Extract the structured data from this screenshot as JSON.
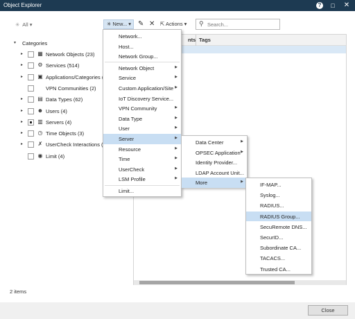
{
  "window": {
    "title": "Object Explorer",
    "help_glyph": "?",
    "maximize_glyph": "□",
    "close_glyph": "✕"
  },
  "toolbar": {
    "filter_label": "All",
    "new_label": "New...",
    "actions_label": "Actions",
    "search_placeholder": "Search..."
  },
  "tree": {
    "root_label": "Categories",
    "items": [
      {
        "label": "Network Objects (23)",
        "icon": "network-icon",
        "checked": false,
        "expandable": true
      },
      {
        "label": "Services (514)",
        "icon": "services-icon",
        "checked": false,
        "expandable": true
      },
      {
        "label": "Applications/Categories (",
        "icon": "applications-icon",
        "checked": false,
        "expandable": true
      },
      {
        "label": "VPN Communities (2)",
        "icon": "",
        "checked": false,
        "expandable": false
      },
      {
        "label": "Data Types (62)",
        "icon": "data-types-icon",
        "checked": false,
        "expandable": true
      },
      {
        "label": "Users (4)",
        "icon": "users-icon",
        "checked": false,
        "expandable": true
      },
      {
        "label": "Servers (4)",
        "icon": "servers-icon",
        "checked": true,
        "expandable": true
      },
      {
        "label": "Time Objects (3)",
        "icon": "time-icon",
        "checked": false,
        "expandable": true
      },
      {
        "label": "UserCheck Interactions (1",
        "icon": "usercheck-icon",
        "checked": false,
        "expandable": true
      },
      {
        "label": "Limit (4)",
        "icon": "limit-icon",
        "checked": false,
        "expandable": false
      }
    ]
  },
  "grid": {
    "columns": [
      "nts",
      "Tags"
    ]
  },
  "status": {
    "item_count": "2 items"
  },
  "footer": {
    "close_label": "Close"
  },
  "menu_new": {
    "items": [
      {
        "label": "Network...",
        "submenu": false
      },
      {
        "label": "Host...",
        "submenu": false
      },
      {
        "label": "Network Group...",
        "submenu": false
      },
      {
        "label": "Network Object",
        "submenu": true
      },
      {
        "label": "Service",
        "submenu": true
      },
      {
        "label": "Custom Application/Site",
        "submenu": true
      },
      {
        "label": "IoT Discovery Service...",
        "submenu": false
      },
      {
        "label": "VPN Community",
        "submenu": true
      },
      {
        "label": "Data Type",
        "submenu": true
      },
      {
        "label": "User",
        "submenu": true
      },
      {
        "label": "Server",
        "submenu": true,
        "highlighted": true
      },
      {
        "label": "Resource",
        "submenu": true
      },
      {
        "label": "Time",
        "submenu": true
      },
      {
        "label": "UserCheck",
        "submenu": true
      },
      {
        "label": "LSM Profile",
        "submenu": true
      },
      {
        "label": "Limit...",
        "submenu": false
      }
    ]
  },
  "menu_server": {
    "items": [
      {
        "label": "Data Center",
        "submenu": true
      },
      {
        "label": "OPSEC Application",
        "submenu": true
      },
      {
        "label": "Identity Provider...",
        "submenu": false
      },
      {
        "label": "LDAP Account Unit...",
        "submenu": false
      },
      {
        "label": "More",
        "submenu": true,
        "highlighted": true
      }
    ]
  },
  "menu_more": {
    "items": [
      {
        "label": "IF-MAP...",
        "submenu": false
      },
      {
        "label": "Syslog...",
        "submenu": false
      },
      {
        "label": "RADIUS...",
        "submenu": false
      },
      {
        "label": "RADIUS Group...",
        "submenu": false,
        "highlighted": true
      },
      {
        "label": "SecuRemote DNS...",
        "submenu": false
      },
      {
        "label": "SecurID...",
        "submenu": false
      },
      {
        "label": "Subordinate CA...",
        "submenu": false
      },
      {
        "label": "TACACS...",
        "submenu": false
      },
      {
        "label": "Trusted CA...",
        "submenu": false
      }
    ]
  },
  "colors": {
    "titlebar": "#1d3a52",
    "highlight": "#c8def3",
    "new_button": "#d6e5f3"
  }
}
